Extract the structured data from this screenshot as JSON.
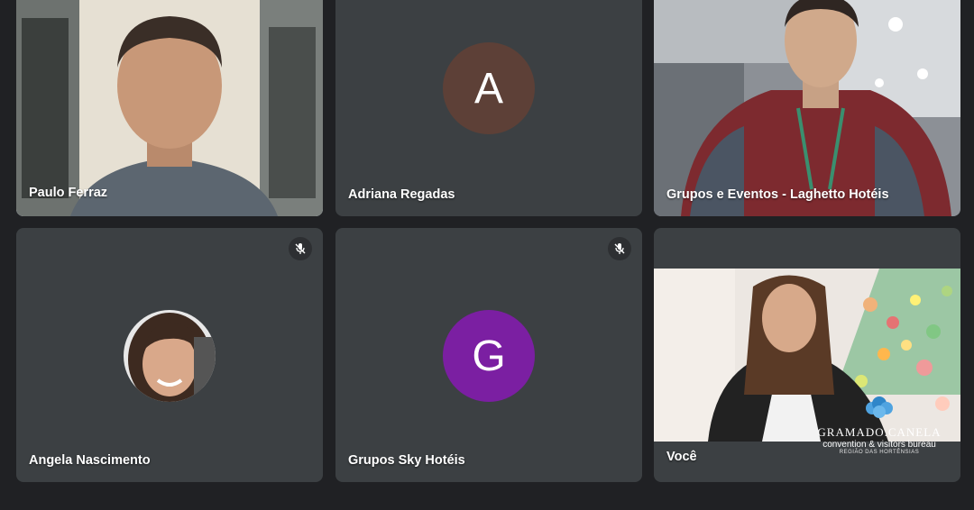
{
  "participants": [
    {
      "name": "Paulo Ferraz",
      "type": "video",
      "active": true,
      "muted": false
    },
    {
      "name": "Adriana Regadas",
      "type": "avatar",
      "initial": "A",
      "avatar_color": "#5d4037",
      "muted": false
    },
    {
      "name": "Grupos e Eventos - Laghetto Hotéis",
      "type": "video",
      "muted": false
    },
    {
      "name": "Angela Nascimento",
      "type": "photo-avatar",
      "muted": true
    },
    {
      "name": "Grupos Sky Hotéis",
      "type": "avatar",
      "initial": "G",
      "avatar_color": "#7b1fa2",
      "muted": true
    },
    {
      "name": "Você",
      "type": "video",
      "muted": false
    }
  ],
  "watermark": {
    "brand": "GRAMADO.CANELA",
    "tagline": "convention & visitors bureau",
    "region": "REGIÃO DAS HORTÊNSIAS"
  },
  "colors": {
    "background": "#202124",
    "tile": "#3c4043",
    "active_border": "#8ab4f8"
  }
}
